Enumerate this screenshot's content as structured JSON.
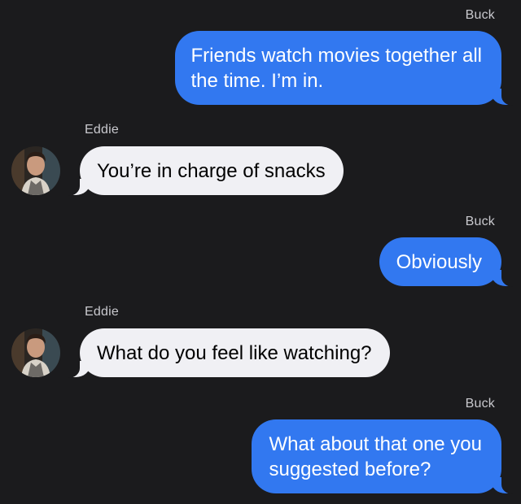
{
  "colors": {
    "background": "#1b1b1d",
    "outgoing_bubble": "#3278f0",
    "incoming_bubble": "#f0f0f4",
    "sender_label": "#c9c9ce"
  },
  "messages": [
    {
      "sender": "Buck",
      "direction": "outgoing",
      "lines": [
        "Friends watch movies together all",
        "the time. I’m in."
      ]
    },
    {
      "sender": "Eddie",
      "direction": "incoming",
      "avatar": "eddie-avatar-photo",
      "lines": [
        "You’re in charge of snacks"
      ]
    },
    {
      "sender": "Buck",
      "direction": "outgoing",
      "lines": [
        "Obviously"
      ]
    },
    {
      "sender": "Eddie",
      "direction": "incoming",
      "avatar": "eddie-avatar-photo",
      "lines": [
        "What do you feel like watching?"
      ]
    },
    {
      "sender": "Buck",
      "direction": "outgoing",
      "lines": [
        "What about that one you",
        "suggested before?"
      ]
    }
  ]
}
